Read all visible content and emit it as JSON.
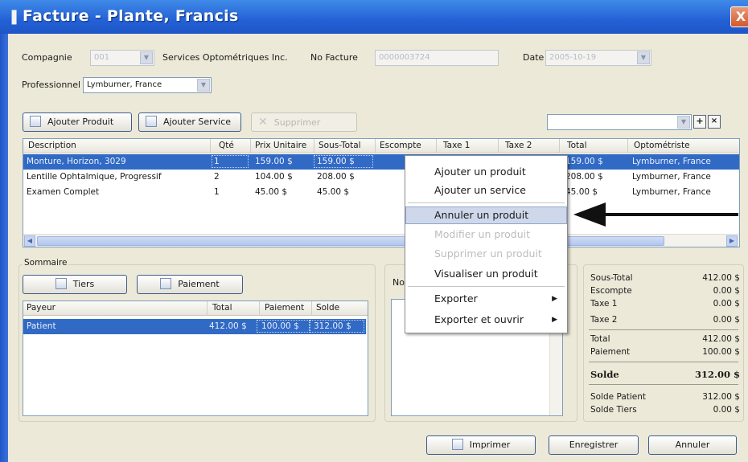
{
  "window": {
    "title": "Facture - Plante, Francis",
    "close_glyph": "X"
  },
  "header": {
    "compagnie_label": "Compagnie",
    "compagnie_code": "001",
    "compagnie_name": "Services Optométriques Inc.",
    "no_facture_label": "No Facture",
    "no_facture_value": "0000003724",
    "date_label": "Date",
    "date_value": "2005-10-19",
    "professionnel_label": "Professionnel",
    "professionnel_value": "Lymburner, France"
  },
  "toolbar": {
    "add_product": "Ajouter Produit",
    "add_service": "Ajouter Service",
    "delete": "Supprimer"
  },
  "products": {
    "columns": [
      "Description",
      "Qté",
      "Prix Unitaire",
      "Sous-Total",
      "Escompte",
      "Taxe 1",
      "Taxe 2",
      "Total",
      "Optométriste"
    ],
    "rows": [
      [
        "Monture, Horizon, 3029",
        "1",
        "159.00 $",
        "159.00 $",
        "",
        "",
        "",
        "159.00 $",
        "Lymburner, France"
      ],
      [
        "Lentille Ophtalmique, Progressif",
        "2",
        "104.00 $",
        "208.00 $",
        "",
        "",
        "",
        "208.00 $",
        "Lymburner, France"
      ],
      [
        "Examen Complet",
        "1",
        "45.00 $",
        "45.00 $",
        "",
        "",
        "",
        "45.00 $",
        "Lymburner, France"
      ]
    ]
  },
  "sommaire": {
    "title": "Sommaire",
    "tiers_button": "Tiers",
    "paiement_button": "Paiement",
    "columns": [
      "Payeur",
      "Total",
      "Paiement",
      "Solde"
    ],
    "rows": [
      [
        "Patient",
        "412.00 $",
        "100.00 $",
        "312.00 $"
      ]
    ]
  },
  "notes": {
    "label": "Not"
  },
  "totals": {
    "sous_total_label": "Sous-Total",
    "sous_total": "412.00 $",
    "escompte_label": "Escompte",
    "escompte": "0.00 $",
    "taxe1_label": "Taxe 1",
    "taxe1": "0.00 $",
    "taxe2_label": "Taxe 2",
    "taxe2": "0.00 $",
    "total_label": "Total",
    "total": "412.00 $",
    "paiement_label": "Paiement",
    "paiement": "100.00 $",
    "solde_label": "Solde",
    "solde": "312.00 $",
    "solde_patient_label": "Solde Patient",
    "solde_patient": "312.00 $",
    "solde_tiers_label": "Solde Tiers",
    "solde_tiers": "0.00 $"
  },
  "context_menu": {
    "items": [
      {
        "label": "Ajouter un produit",
        "state": "normal"
      },
      {
        "label": "Ajouter un service",
        "state": "normal"
      },
      {
        "label": "Annuler un produit",
        "state": "hover"
      },
      {
        "label": "Modifier un produit",
        "state": "disabled"
      },
      {
        "label": "Supprimer un produit",
        "state": "disabled"
      },
      {
        "label": "Visualiser un produit",
        "state": "normal"
      },
      {
        "label": "Exporter",
        "state": "submenu"
      },
      {
        "label": "Exporter et ouvrir",
        "state": "submenu"
      }
    ]
  },
  "footer": {
    "print": "Imprimer",
    "save": "Enregistrer",
    "cancel": "Annuler"
  },
  "colors": {
    "title_bar": "#2461d6",
    "selection": "#316ac5",
    "window_bg": "#ece9d8",
    "menu_hover": "#cfd8ea"
  }
}
